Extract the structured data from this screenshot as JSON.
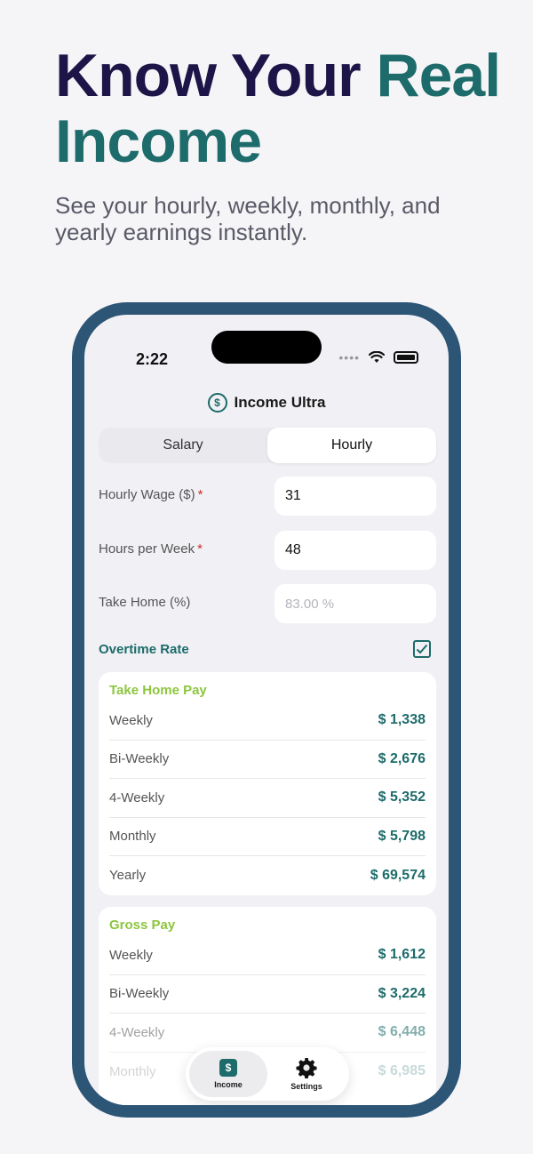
{
  "hero": {
    "title_part1": "Know Your ",
    "title_accent": "Real Income",
    "subtitle": "See your hourly, weekly, monthly, and yearly earnings instantly."
  },
  "status_bar": {
    "time": "2:22"
  },
  "app": {
    "title": "Income Ultra",
    "icon": "dollar-circle-icon"
  },
  "segmented": {
    "salary_label": "Salary",
    "hourly_label": "Hourly",
    "selected": "Hourly"
  },
  "form": {
    "hourly_wage_label": "Hourly Wage ($)",
    "hourly_wage_value": "31",
    "hours_per_week_label": "Hours per Week",
    "hours_per_week_value": "48",
    "take_home_label": "Take Home (%)",
    "take_home_placeholder": "83.00 %",
    "required_mark": "*",
    "overtime_label": "Overtime Rate",
    "overtime_checked": true
  },
  "take_home_pay": {
    "title": "Take Home Pay",
    "rows": [
      {
        "label": "Weekly",
        "value": "$ 1,338"
      },
      {
        "label": "Bi-Weekly",
        "value": "$ 2,676"
      },
      {
        "label": "4-Weekly",
        "value": "$ 5,352"
      },
      {
        "label": "Monthly",
        "value": "$ 5,798"
      },
      {
        "label": "Yearly",
        "value": "$ 69,574"
      }
    ]
  },
  "gross_pay": {
    "title": "Gross Pay",
    "rows": [
      {
        "label": "Weekly",
        "value": "$ 1,612"
      },
      {
        "label": "Bi-Weekly",
        "value": "$ 3,224"
      },
      {
        "label": "4-Weekly",
        "value": "$ 6,448"
      },
      {
        "label": "Monthly",
        "value": "$ 6,985"
      }
    ]
  },
  "tabbar": {
    "income_label": "Income",
    "settings_label": "Settings",
    "active": "Income"
  },
  "colors": {
    "brand_teal": "#1d6b6a",
    "heading_navy": "#1d1547",
    "section_green": "#8cc63e",
    "phone_frame": "#2d5576",
    "required_red": "#cc2b2b"
  }
}
